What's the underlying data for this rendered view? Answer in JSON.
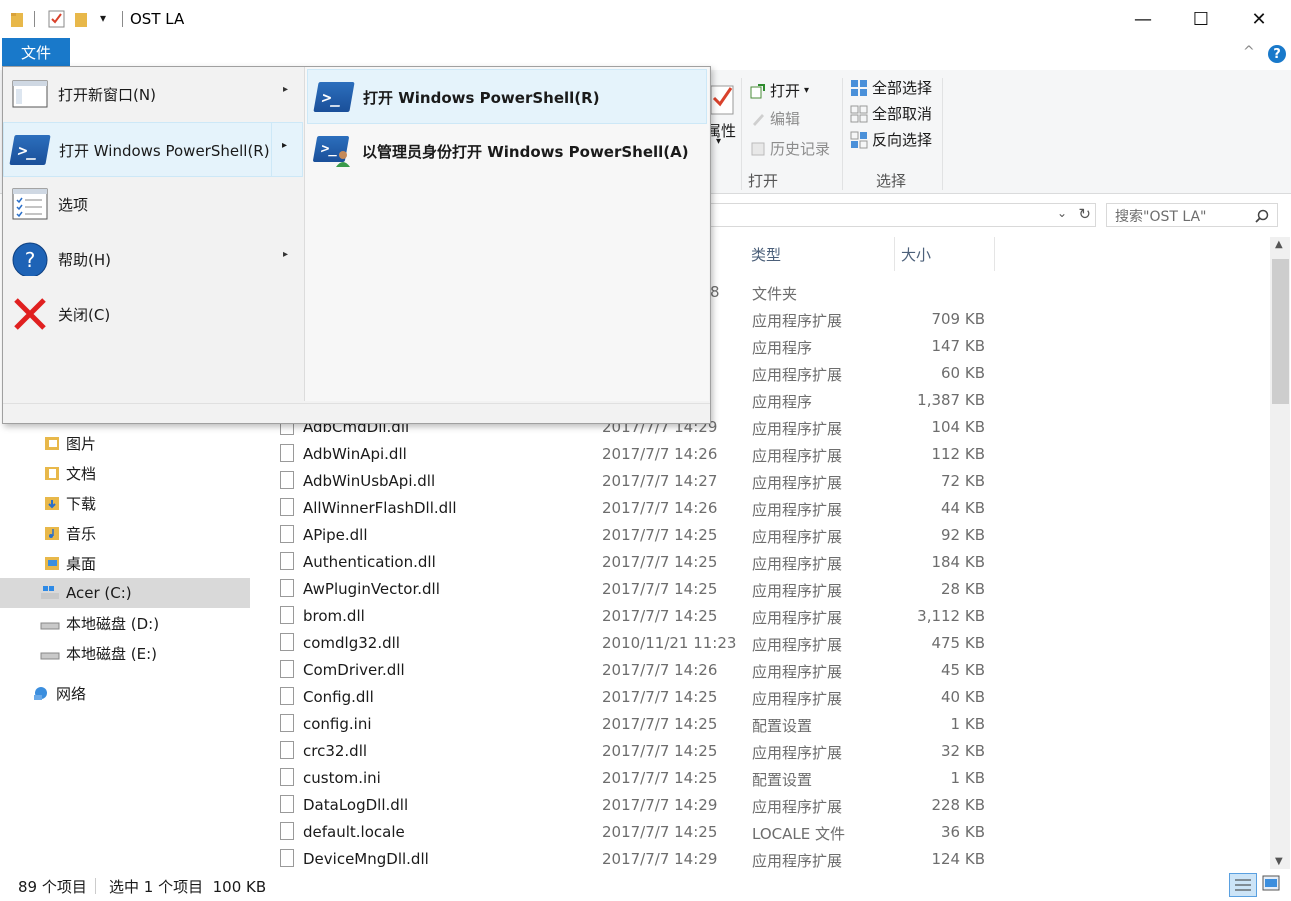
{
  "window": {
    "title": "OST LA",
    "minimize": "—",
    "maximize": "☐",
    "close": "✕"
  },
  "quick_access": {
    "dropdown": "▾"
  },
  "tabs": {
    "file_label": "文件",
    "help": "?",
    "collapse": "^"
  },
  "ribbon": {
    "properties_label": "属性",
    "open_label": "打开",
    "open_dropdown": "▾",
    "edit_label": "编辑",
    "history_label": "历史记录",
    "open_group": "打开",
    "select_all": "全部选择",
    "select_none": "全部取消",
    "invert_selection": "反向选择",
    "select_group": "选择"
  },
  "search": {
    "placeholder": "搜索\"OST LA\""
  },
  "file_menu": {
    "items": [
      {
        "label": "打开新窗口(N)",
        "arrow": "▸"
      },
      {
        "label": "打开 Windows PowerShell(R)",
        "arrow": "▸"
      },
      {
        "label": "选项",
        "arrow": ""
      },
      {
        "label": "帮助(H)",
        "arrow": "▸"
      },
      {
        "label": "关闭(C)",
        "arrow": ""
      }
    ],
    "submenu": [
      {
        "label": "打开 Windows PowerShell(R)"
      },
      {
        "label": "以管理员身份打开 Windows PowerShell(A)"
      }
    ]
  },
  "nav": {
    "items": [
      {
        "label": "图片"
      },
      {
        "label": "文档"
      },
      {
        "label": "下载"
      },
      {
        "label": "音乐"
      },
      {
        "label": "桌面"
      },
      {
        "label": "Acer (C:)"
      },
      {
        "label": "本地磁盘 (D:)"
      },
      {
        "label": "本地磁盘 (E:)"
      },
      {
        "label": "网络"
      }
    ]
  },
  "columns": {
    "type": "类型",
    "size": "大小"
  },
  "partial_rows": [
    {
      "date_fragment": "8",
      "type": "文件夹",
      "size": ""
    },
    {
      "date_fragment": "",
      "type": "应用程序扩展",
      "size": "709 KB"
    },
    {
      "date_fragment": "",
      "type": "应用程序",
      "size": "147 KB"
    },
    {
      "date_fragment": "",
      "type": "应用程序扩展",
      "size": "60 KB"
    },
    {
      "date_fragment": "",
      "type": "应用程序",
      "size": "1,387 KB"
    }
  ],
  "files": [
    {
      "name": "AdbCmdDll.dll",
      "date": "2017/7/7 14:29",
      "type": "应用程序扩展",
      "size": "104 KB"
    },
    {
      "name": "AdbWinApi.dll",
      "date": "2017/7/7 14:26",
      "type": "应用程序扩展",
      "size": "112 KB"
    },
    {
      "name": "AdbWinUsbApi.dll",
      "date": "2017/7/7 14:27",
      "type": "应用程序扩展",
      "size": "72 KB"
    },
    {
      "name": "AllWinnerFlashDll.dll",
      "date": "2017/7/7 14:26",
      "type": "应用程序扩展",
      "size": "44 KB"
    },
    {
      "name": "APipe.dll",
      "date": "2017/7/7 14:25",
      "type": "应用程序扩展",
      "size": "92 KB"
    },
    {
      "name": "Authentication.dll",
      "date": "2017/7/7 14:25",
      "type": "应用程序扩展",
      "size": "184 KB"
    },
    {
      "name": "AwPluginVector.dll",
      "date": "2017/7/7 14:25",
      "type": "应用程序扩展",
      "size": "28 KB"
    },
    {
      "name": "brom.dll",
      "date": "2017/7/7 14:25",
      "type": "应用程序扩展",
      "size": "3,112 KB"
    },
    {
      "name": "comdlg32.dll",
      "date": "2010/11/21 11:23",
      "type": "应用程序扩展",
      "size": "475 KB"
    },
    {
      "name": "ComDriver.dll",
      "date": "2017/7/7 14:26",
      "type": "应用程序扩展",
      "size": "45 KB"
    },
    {
      "name": "Config.dll",
      "date": "2017/7/7 14:25",
      "type": "应用程序扩展",
      "size": "40 KB"
    },
    {
      "name": "config.ini",
      "date": "2017/7/7 14:25",
      "type": "配置设置",
      "size": "1 KB"
    },
    {
      "name": "crc32.dll",
      "date": "2017/7/7 14:25",
      "type": "应用程序扩展",
      "size": "32 KB"
    },
    {
      "name": "custom.ini",
      "date": "2017/7/7 14:25",
      "type": "配置设置",
      "size": "1 KB"
    },
    {
      "name": "DataLogDll.dll",
      "date": "2017/7/7 14:29",
      "type": "应用程序扩展",
      "size": "228 KB"
    },
    {
      "name": "default.locale",
      "date": "2017/7/7 14:25",
      "type": "LOCALE 文件",
      "size": "36 KB"
    },
    {
      "name": "DeviceMngDll.dll",
      "date": "2017/7/7 14:29",
      "type": "应用程序扩展",
      "size": "124 KB"
    }
  ],
  "status": {
    "item_count": "89 个项目",
    "selection": "选中 1 个项目  100 KB"
  },
  "colors": {
    "accent": "#1979ca",
    "menu_highlight": "#e5f3fb",
    "selected_nav": "#d9d9d9"
  }
}
